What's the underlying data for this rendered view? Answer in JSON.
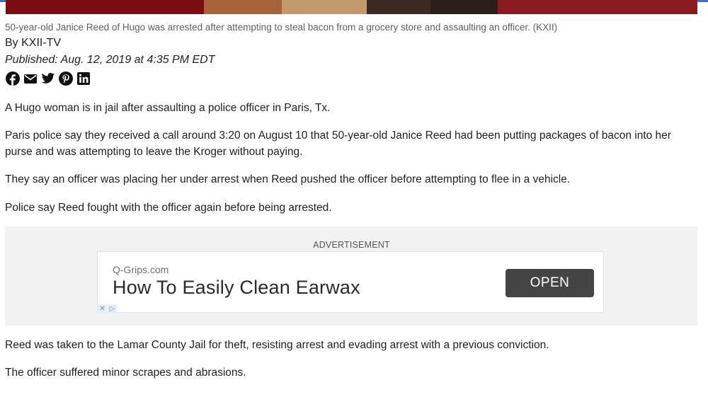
{
  "photo": {
    "colors": [
      "#7a0d12",
      "#3a2a22",
      "#a8623a",
      "#c49a6c",
      "#2b1f1a",
      "#8a1a1f"
    ]
  },
  "article": {
    "caption": "50-year-old Janice Reed of Hugo was arrested after attempting to steal bacon from a grocery store and assaulting an officer.  (KXII)",
    "byline": "By KXII-TV",
    "published": "Published: Aug. 12, 2019 at 4:35 PM EDT",
    "share_icons": [
      "facebook-icon",
      "email-icon",
      "twitter-icon",
      "pinterest-icon",
      "linkedin-icon"
    ],
    "paragraphs_top": [
      "A Hugo woman is in jail after assaulting a police officer in Paris, Tx.",
      "Paris police say they received a call around 3:20 on August 10 that 50-year-old Janice Reed had been putting packages of bacon into her purse and was attempting to leave the Kroger without paying.",
      "They say an officer was placing her under arrest when Reed pushed the officer before attempting to flee in a vehicle.",
      "Police say Reed fought with the officer again before being arrested."
    ],
    "paragraphs_bottom": [
      "Reed was taken to the Lamar County Jail for theft, resisting arrest and evading arrest with a previous conviction.",
      "The officer suffered minor scrapes and abrasions."
    ]
  },
  "ad": {
    "label": "ADVERTISEMENT",
    "domain": "Q-Grips.com",
    "headline": "How To Easily Clean Earwax",
    "button": "OPEN",
    "icons": [
      "close-x-icon",
      "adchoices-icon"
    ]
  },
  "colors": {
    "accent_top": "#3b73c8",
    "text": "#222222",
    "caption": "#5f5f5f",
    "ad_button": "#444444"
  }
}
